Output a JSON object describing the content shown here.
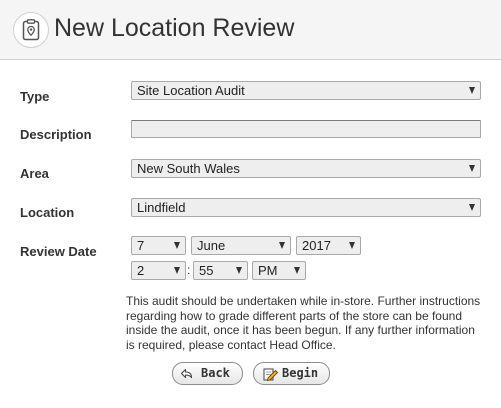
{
  "header": {
    "title": "New Location Review",
    "icon": "clipboard-location-icon"
  },
  "form": {
    "type": {
      "label": "Type",
      "value": "Site Location Audit"
    },
    "description": {
      "label": "Description",
      "value": ""
    },
    "area": {
      "label": "Area",
      "value": "New South Wales"
    },
    "location": {
      "label": "Location",
      "value": "Lindfield"
    },
    "review_date": {
      "label": "Review Date",
      "day": "7",
      "month": "June",
      "year": "2017",
      "hour": "2",
      "minute": "55",
      "ampm": "PM",
      "time_separator": ":"
    }
  },
  "note": "This audit should be undertaken while in-store. Further instructions regarding how to grade different parts of the store can be found inside the audit, once it has been begun. If any further information is required, please contact Head Office.",
  "buttons": {
    "back_label": "Back",
    "back_icon": "back-arrow-icon",
    "begin_label": "Begin",
    "begin_icon": "pencil-note-icon"
  },
  "colors": {
    "header_bg": "#f5f5f5",
    "field_bg": "#eeeeee",
    "text": "#333333"
  }
}
